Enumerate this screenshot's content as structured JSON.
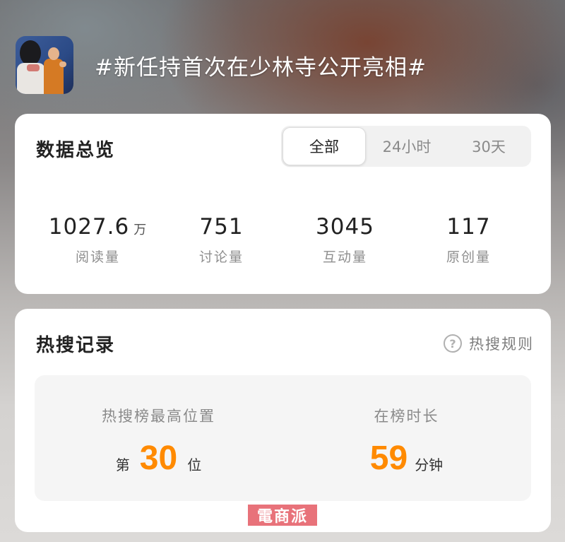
{
  "header": {
    "title": "#新任持首次在少林寺公开亮相#"
  },
  "overview": {
    "title": "数据总览",
    "tabs": [
      {
        "label": "全部",
        "active": true
      },
      {
        "label": "24小时",
        "active": false
      },
      {
        "label": "30天",
        "active": false
      }
    ],
    "stats": [
      {
        "value": "1027.6",
        "unit": "万",
        "label": "阅读量"
      },
      {
        "value": "751",
        "unit": "",
        "label": "讨论量"
      },
      {
        "value": "3045",
        "unit": "",
        "label": "互动量"
      },
      {
        "value": "117",
        "unit": "",
        "label": "原创量"
      }
    ]
  },
  "hot_search": {
    "title": "热搜记录",
    "rule_icon": "question-circle-icon",
    "rule_label": "热搜规则",
    "highest_rank": {
      "label": "热搜榜最高位置",
      "prefix": "第",
      "value": "30",
      "suffix": "位"
    },
    "duration": {
      "label": "在榜时长",
      "value": "59",
      "suffix": "分钟"
    }
  },
  "watermark": "電商派",
  "colors": {
    "accent": "#ff8a00",
    "card_bg": "#ffffff",
    "watermark_bg": "#e8727a"
  }
}
